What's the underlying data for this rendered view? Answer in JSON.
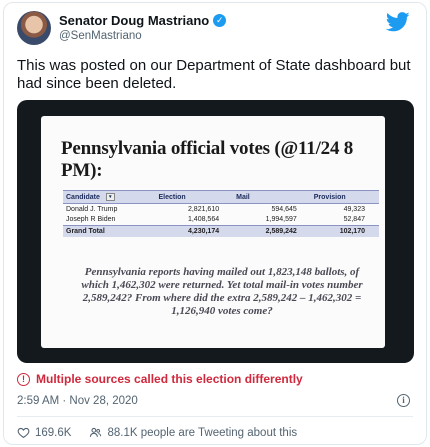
{
  "author": {
    "name": "Senator Doug Mastriano",
    "handle": "@SenMastriano"
  },
  "icons": {
    "verified": "verified-badge-icon",
    "brand": "twitter-bird-icon",
    "warning": "warning-circle-icon",
    "info": "info-icon",
    "like": "heart-icon",
    "retweet": "people-icon"
  },
  "colors": {
    "accent": "#1d9bf0",
    "warning": "#d0283c",
    "muted": "#536471"
  },
  "tweet": {
    "text": "This was posted on our Department of State dashboard but had since been deleted."
  },
  "image": {
    "title": "Pennsylvania official votes (@11/24 8 PM):",
    "table": {
      "headers": [
        "Candidate",
        "Election",
        "Mail",
        "Provision"
      ],
      "rows": [
        [
          "Donald J. Trump",
          "2,821,610",
          "594,645",
          "49,323"
        ],
        [
          "Joseph R Biden",
          "1,408,564",
          "1,994,597",
          "52,847"
        ]
      ],
      "total": [
        "Grand Total",
        "4,230,174",
        "2,589,242",
        "102,170"
      ]
    },
    "quote": "Pennsylvania reports having mailed out 1,823,148 ballots, of which 1,462,302 were returned. Yet total mail-in votes number 2,589,242? From where did the extra 2,589,242 – 1,462,302 = 1,126,940 votes come?"
  },
  "notice": "Multiple sources called this election differently",
  "timestamp": "2:59 AM · Nov 28, 2020",
  "actions": {
    "likes": "169.6K",
    "retweets": "88.1K people are Tweeting about this"
  }
}
